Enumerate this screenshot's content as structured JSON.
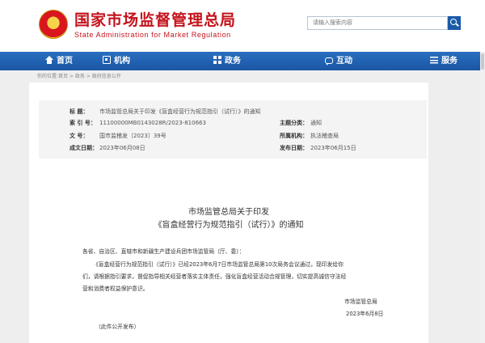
{
  "header": {
    "title_cn": "国家市场监督管理总局",
    "title_en": "State Administration for Market Regulation",
    "search_placeholder": "请输入搜索内容"
  },
  "nav": {
    "items": [
      {
        "label": "首页",
        "icon": "home-icon"
      },
      {
        "label": "机构",
        "icon": "building-icon"
      },
      {
        "label": "政务",
        "icon": "grid-icon"
      },
      {
        "label": "互动",
        "icon": "chat-icon"
      },
      {
        "label": "服务",
        "icon": "list-icon"
      }
    ]
  },
  "breadcrumb": "你的位置:首页 > 政务 > 政府信息公开",
  "meta": {
    "title_label": "标 题：",
    "title_value": "市场监管总局关于印发《盲盒经营行为规范指引（试行）》的通知",
    "index_label": "索 引 号：",
    "index_value": "11100000MB0143028R/2023-810663",
    "doc_no_label": "文 号：",
    "doc_no_value": "国市监稽发〔2023〕39号",
    "date_label": "成文日期：",
    "date_value": "2023年06月08日",
    "category_label": "主题分类：",
    "category_value": "通知",
    "org_label": "所属机构：",
    "org_value": "执法稽查局",
    "publish_label": "发布日期：",
    "publish_value": "2023年06月15日"
  },
  "article": {
    "title_line1": "市场监管总局关于印发",
    "title_line2": "《盲盒经营行为规范指引（试行）》的通知",
    "salutation": "各省、自治区、直辖市和新疆生产建设兵团市场监管局（厅、委）：",
    "para_line1": "《盲盒经营行为规范指引（试行）》已经2023年6月7日市场监管总局第10次局务会议通过，现印发给你",
    "para_line2": "们，请根据指引要求，督促指导相关经营者落实主体责任，强化盲盒经营活动合规管理，切实提高诚信守法经",
    "para_line3": "营和消费者权益保护意识。",
    "signature": "市场监管总局",
    "sign_date": "2023年6月8日",
    "note": "（此件公开发布）"
  }
}
